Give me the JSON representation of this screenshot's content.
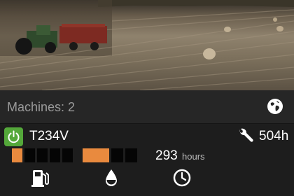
{
  "hero": {
    "image": "harvest-field-photo"
  },
  "summary": {
    "machines_label": "Machines: 2",
    "globe_icon": "globe-icon"
  },
  "machine": {
    "power_icon": "power-icon",
    "power_color": "#54a83a",
    "id": "T234V",
    "maintenance_icon": "wrench-icon",
    "total_hours": "504h",
    "fuel_level_segments": 1,
    "fuel_total_segments": 5,
    "def_level_fraction": 0.5,
    "engine_hours_value": "293",
    "engine_hours_unit": "hours",
    "gauge_color": "#e98a3e"
  },
  "bottom_icons": [
    "fuel-pump-icon",
    "water-drop-icon",
    "clock-icon"
  ]
}
